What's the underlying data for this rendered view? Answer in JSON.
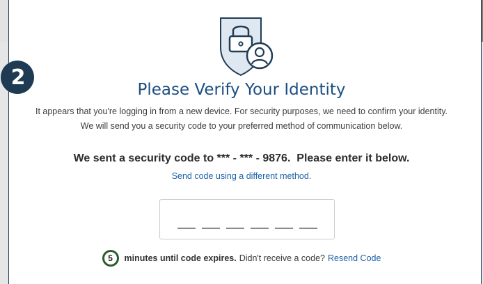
{
  "step_number": "2",
  "title": "Please Verify Your Identity",
  "description": {
    "line1": "It appears that you're logging in from a new device. For security purposes, we need to confirm your identity.",
    "line2": "We will send you a security code to your preferred method of communication below."
  },
  "sent_message": "We sent a security code to *** - *** - 9876.  Please enter it below.",
  "alternate_method_link": "Send code using a different method.",
  "code_input": {
    "digits": 6,
    "value": ""
  },
  "expiry": {
    "minutes": "5",
    "text": "minutes until code expires.",
    "question": "Didn't receive a code?",
    "resend_label": "Resend Code"
  },
  "icons": {
    "shield": "shield-lock-user-icon"
  },
  "colors": {
    "title": "#1c4e80",
    "link": "#1d62a8",
    "badge": "#1e3b53",
    "timer_ring": "#2b5d2c"
  }
}
